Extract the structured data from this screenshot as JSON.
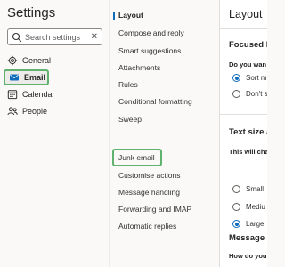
{
  "left": {
    "title": "Settings",
    "search": {
      "placeholder": "Search settings"
    },
    "nav": [
      {
        "label": "General",
        "icon": "gear-icon"
      },
      {
        "label": "Email",
        "icon": "mail-icon"
      },
      {
        "label": "Calendar",
        "icon": "calendar-icon"
      },
      {
        "label": "People",
        "icon": "people-icon"
      }
    ]
  },
  "middle": {
    "items": [
      "Layout",
      "Compose and reply",
      "Smart suggestions",
      "Attachments",
      "Rules",
      "Conditional formatting",
      "Sweep",
      "Junk email",
      "Customise actions",
      "Message handling",
      "Forwarding and IMAP",
      "Automatic replies"
    ]
  },
  "right": {
    "title": "Layout",
    "focused": {
      "heading": "Focused I",
      "question": "Do you wan",
      "options": [
        "Sort m",
        "Don't s"
      ]
    },
    "text_size": {
      "heading": "Text size a",
      "question": "This will cha",
      "options": [
        "Small",
        "Mediu",
        "Large"
      ]
    },
    "message": {
      "heading": "Message c",
      "question": "How do you"
    }
  },
  "colors": {
    "accent": "#0f6cbd",
    "highlight": "#5fb36e"
  }
}
